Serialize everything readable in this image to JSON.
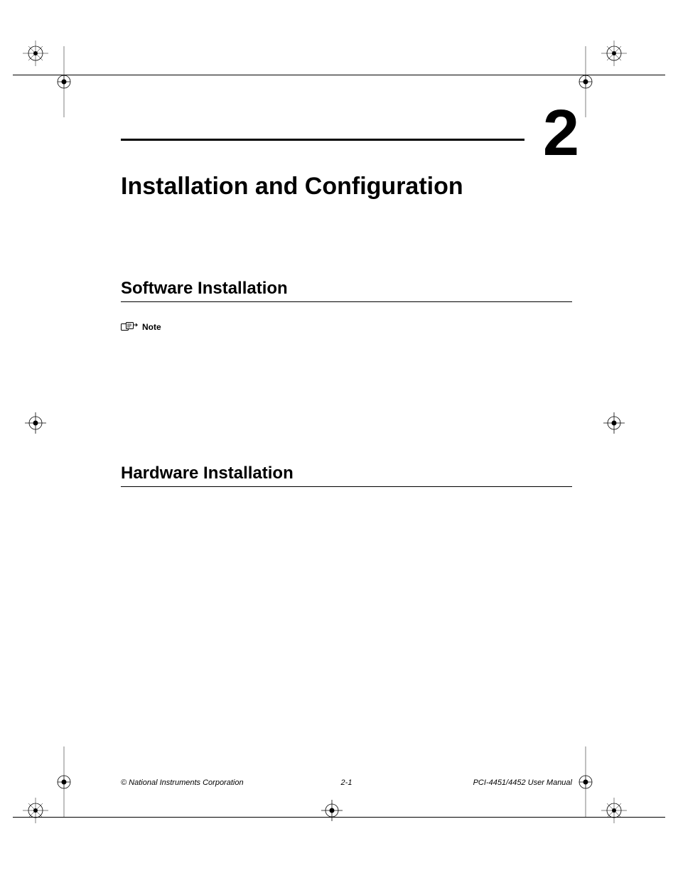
{
  "chapter": {
    "number": "2",
    "title": "Installation and Configuration"
  },
  "sections": {
    "software": "Software Installation",
    "hardware": "Hardware Installation"
  },
  "note": {
    "label": "Note"
  },
  "footer": {
    "left": "© National Instruments Corporation",
    "center": "2-1",
    "right": "PCI-4451/4452 User Manual"
  }
}
